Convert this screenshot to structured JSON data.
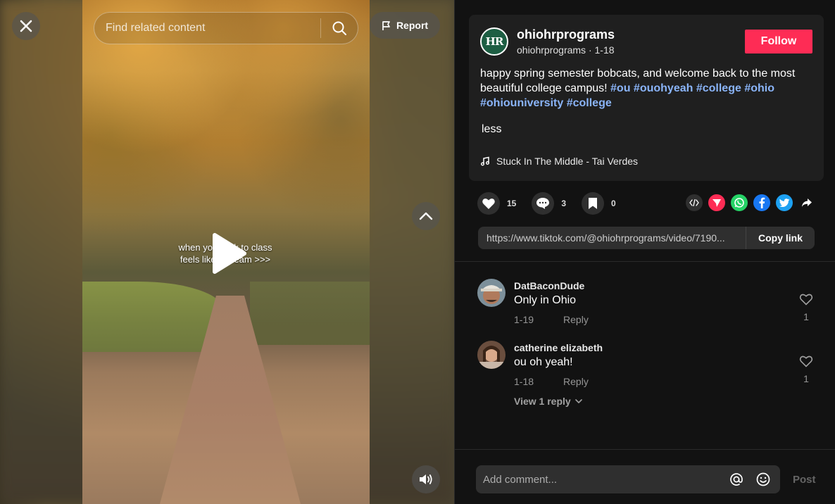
{
  "video": {
    "search_placeholder": "Find related content",
    "report_label": "Report",
    "caption_line1": "when you walk to class",
    "caption_line2": "feels like a dream >>>"
  },
  "post": {
    "avatar_text": "HR",
    "username": "ohiohrprograms",
    "handle": "ohiohrprograms",
    "date": "1-18",
    "follow_label": "Follow",
    "description": "happy spring semester bobcats, and welcome back to the most beautiful college campus!",
    "hashtags": [
      "#ou",
      "#ouohyeah",
      "#college",
      "#ohio",
      "#ohiouniversity",
      "#college"
    ],
    "less_label": "less",
    "music": "Stuck In The Middle - Tai Verdes"
  },
  "actions": {
    "likes": "15",
    "comments": "3",
    "saves": "0"
  },
  "share": {
    "link": "https://www.tiktok.com/@ohiohrprograms/video/7190...",
    "copy_label": "Copy link",
    "colors": {
      "embed": "#2f2f2f",
      "friends": "#fe2c55",
      "whatsapp": "#25d366",
      "facebook": "#1877f2",
      "twitter": "#1da1f2"
    }
  },
  "comments": [
    {
      "name": "DatBaconDude",
      "text": "Only in Ohio",
      "date": "1-19",
      "reply_label": "Reply",
      "likes": "1"
    },
    {
      "name": "catherine elizabeth",
      "text": "ou oh yeah!",
      "date": "1-18",
      "reply_label": "Reply",
      "likes": "1",
      "view_replies": "View 1 reply"
    }
  ],
  "composer": {
    "placeholder": "Add comment...",
    "post_label": "Post"
  },
  "colors": {
    "accent": "#fe2c55",
    "hashtag": "#8ab4f8",
    "panel_bg": "#121212",
    "card_bg": "#1f1f1f"
  }
}
